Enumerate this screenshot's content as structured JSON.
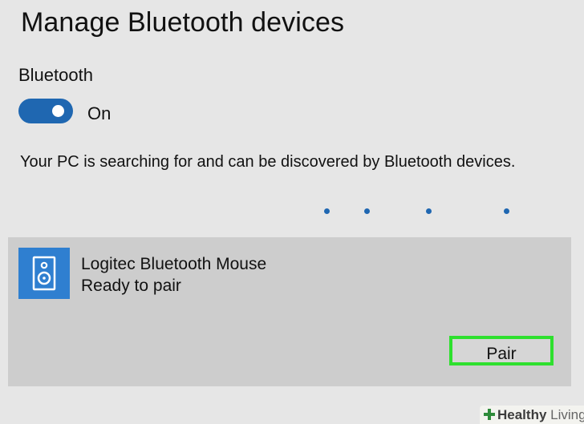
{
  "header": {
    "title": "Manage Bluetooth devices"
  },
  "bluetooth": {
    "label": "Bluetooth",
    "toggle_state": "On",
    "toggle_on": true,
    "status_text": "Your PC is searching for and can be discovered by Bluetooth devices."
  },
  "searching_indicator": {
    "dot_count": 4
  },
  "device": {
    "name": "Logitec Bluetooth Mouse",
    "status": "Ready to pair",
    "icon": "speaker-icon",
    "pair_label": "Pair"
  },
  "watermark": {
    "brand_bold": "Healthy",
    "brand_light": "Living"
  },
  "colors": {
    "accent": "#1f67b1",
    "device_icon_bg": "#2f7fd0",
    "highlight": "#2ee02e",
    "page_bg": "#e6e6e6",
    "card_bg": "#cdcdcd"
  }
}
